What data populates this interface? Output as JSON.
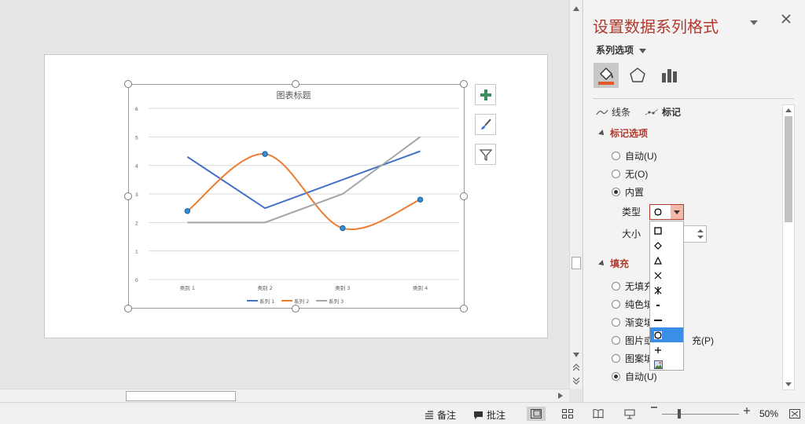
{
  "chart_data": {
    "type": "line",
    "title": "图表标题",
    "categories": [
      "类别 1",
      "类别 2",
      "类别 3",
      "类别 4"
    ],
    "ylim": [
      0,
      6
    ],
    "yticks": [
      "0",
      "1",
      "2",
      "3",
      "4",
      "5",
      "6"
    ],
    "grid": true,
    "legend": "bottom",
    "series": [
      {
        "name": "系列 1",
        "values": [
          4.3,
          2.5,
          3.5,
          4.5
        ],
        "color": "#4472c4",
        "smooth": false
      },
      {
        "name": "系列 2",
        "values": [
          2.4,
          4.4,
          1.8,
          2.8
        ],
        "color": "#ed7d31",
        "smooth": true,
        "markers": true
      },
      {
        "name": "系列 3",
        "values": [
          2,
          2,
          3,
          5
        ],
        "color": "#a5a5a5",
        "smooth": false
      }
    ]
  },
  "pane": {
    "title": "设置数据系列格式",
    "series_options": "系列选项",
    "tab_line": "线条",
    "tab_marker": "标记",
    "marker_section": "标记选项",
    "radio_auto": "自动(U)",
    "radio_none": "无(O)",
    "radio_builtin": "内置",
    "type_label": "类型",
    "size_label": "大小",
    "fill_section": "填充",
    "fill_none": "无填充",
    "fill_solid": "纯色填",
    "fill_gradient": "渐变填",
    "fill_picture_a": "图片或",
    "fill_picture_b": "充(P)",
    "fill_pattern": "图案填",
    "fill_auto": "自动(U)"
  },
  "dropdown": {
    "options": [
      "square-marker",
      "diamond-marker",
      "triangle-marker",
      "x-marker",
      "star-marker",
      "short-dash-marker",
      "long-dash-marker",
      "circle-marker",
      "plus-marker",
      "picture-marker"
    ],
    "selected": "circle-marker"
  },
  "status": {
    "notes": "备注",
    "comments": "批注",
    "zoom": "50%"
  }
}
